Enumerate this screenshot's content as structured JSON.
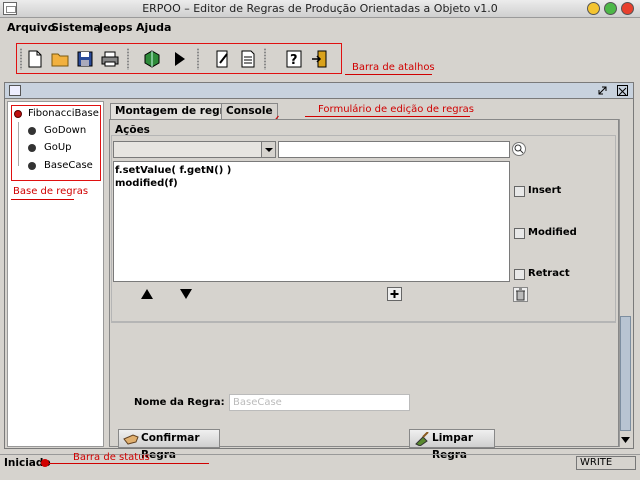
{
  "window": {
    "title": "ERPOO – Editor de Regras de Produção Orientadas a Objeto v1.0"
  },
  "menu": {
    "items": [
      "Arquivo",
      "Sistema",
      "Jeops",
      "Ajuda"
    ]
  },
  "toolbar": {
    "annotation": "Barra de atalhos",
    "icons": [
      "new-file-icon",
      "open-folder-icon",
      "save-icon",
      "print-icon",
      "compile-icon",
      "run-icon",
      "edit-rule-icon",
      "document-icon",
      "help-icon",
      "exit-icon"
    ]
  },
  "tree": {
    "root": "FibonacciBase",
    "items": [
      "GoDown",
      "GoUp",
      "BaseCase"
    ],
    "annotation": "Base de regras"
  },
  "tabs": {
    "montagem": "Montagem de regras",
    "console": "Console"
  },
  "form": {
    "annotation": "Formulário de edição de regras",
    "actions_label": "Ações",
    "combo_value": "",
    "action_input_value": "",
    "code_lines": [
      "f.setValue( f.getN() )",
      "modified(f)"
    ],
    "checkboxes": [
      "Insert",
      "Modified",
      "Retract"
    ],
    "rule_name_label": "Nome da Regra:",
    "rule_name_placeholder": "BaseCase",
    "confirm_button": "Confirmar Regra",
    "clear_button": "Limpar Regra"
  },
  "status": {
    "text": "Iniciado",
    "annotation": "Barra de status",
    "mode": "WRITE"
  },
  "colors": {
    "annotation": "#d00000",
    "frame_bar": "#c8d2de",
    "panel": "#d6d3ce"
  }
}
